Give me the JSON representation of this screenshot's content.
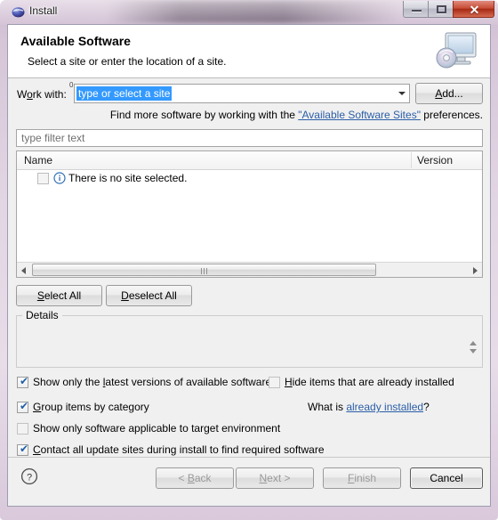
{
  "window": {
    "title": "Install",
    "icon": "eclipse-globe-icon",
    "buttons": {
      "minimize": "minimize-icon",
      "maximize": "maximize-icon",
      "close": "✕"
    }
  },
  "header": {
    "title": "Available Software",
    "description": "Select a site or enter the location of a site.",
    "icon": "monitor-disc-icon"
  },
  "work_with": {
    "label_pre": "W",
    "label_mn": "o",
    "label_post": "rk with:",
    "superscript": "0",
    "value": "type or select a site",
    "add_button": {
      "pre": "",
      "mn": "A",
      "post": "dd..."
    }
  },
  "hint": {
    "prefix": "Find more software by working with the ",
    "link": "\"Available Software Sites\"",
    "suffix": " preferences."
  },
  "filter": {
    "placeholder": "type filter text",
    "value": ""
  },
  "table": {
    "columns": [
      "Name",
      "Version"
    ],
    "rows": [
      {
        "checked": false,
        "icon": "info-icon",
        "name": "There is no site selected.",
        "version": ""
      }
    ]
  },
  "selection_buttons": {
    "select_all": {
      "pre": "",
      "mn": "S",
      "post": "elect All"
    },
    "deselect_all": {
      "pre": "",
      "mn": "D",
      "post": "eselect All"
    }
  },
  "details": {
    "label": "Details",
    "content": ""
  },
  "options": [
    {
      "label_pre": "Show only the ",
      "label_mn": "l",
      "label_post": "atest versions of available software",
      "checked": true,
      "disabled": false
    },
    {
      "label_pre": "",
      "label_mn": "G",
      "label_post": "roup items by category",
      "checked": true,
      "disabled": false
    },
    {
      "label_pre": "Show only software applicable to target environment",
      "label_mn": "",
      "label_post": "",
      "checked": false,
      "disabled": false
    },
    {
      "label_pre": "",
      "label_mn": "C",
      "label_post": "ontact all update sites during install to find required software",
      "checked": true,
      "disabled": false
    },
    {
      "label_pre": "",
      "label_mn": "H",
      "label_post": "ide items that are already installed",
      "checked": false,
      "disabled": true
    }
  ],
  "already_installed": {
    "prefix": "What is ",
    "link": "already installed",
    "suffix": "?"
  },
  "footer": {
    "help": "help-icon",
    "back": {
      "pre": "< ",
      "mn": "B",
      "post": "ack",
      "disabled": true
    },
    "next": {
      "pre": "",
      "mn": "N",
      "post": "ext >",
      "disabled": true
    },
    "finish": {
      "pre": "",
      "mn": "F",
      "post": "inish",
      "disabled": true
    },
    "cancel": {
      "pre": "Cancel",
      "mn": "",
      "post": "",
      "disabled": false
    }
  },
  "colors": {
    "selection_blue": "#3399ff",
    "link_blue": "#2b5ea7",
    "close_red": "#c74d36",
    "dialog_bg": "#f0f0f0"
  }
}
